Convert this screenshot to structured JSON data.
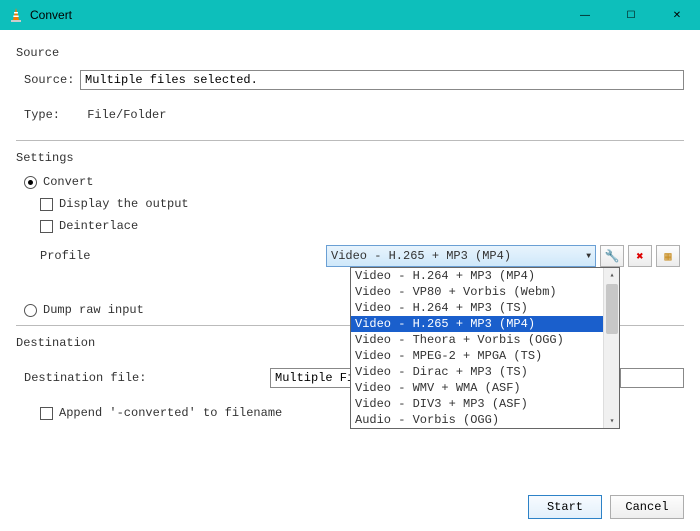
{
  "window": {
    "title": "Convert"
  },
  "source": {
    "section": "Source",
    "label": "Source:",
    "value": "Multiple files selected.",
    "type_label": "Type:",
    "type_value": "File/Folder"
  },
  "settings": {
    "section": "Settings",
    "convert_label": "Convert",
    "display_output_label": "Display the output",
    "deinterlace_label": "Deinterlace",
    "profile_label": "Profile",
    "profile_selected": "Video - H.265 + MP3 (MP4)",
    "profile_options": [
      "Video - H.264 + MP3 (MP4)",
      "Video - VP80 + Vorbis (Webm)",
      "Video - H.264 + MP3 (TS)",
      "Video - H.265 + MP3 (MP4)",
      "Video - Theora + Vorbis (OGG)",
      "Video - MPEG-2 + MPGA (TS)",
      "Video - Dirac + MP3 (TS)",
      "Video - WMV + WMA (ASF)",
      "Video - DIV3 + MP3 (ASF)",
      "Audio - Vorbis (OGG)"
    ],
    "dump_raw_label": "Dump raw input"
  },
  "destination": {
    "section": "Destination",
    "file_label": "Destination file:",
    "file_value": "Multiple Fil",
    "append_label": "Append '-converted' to filename"
  },
  "buttons": {
    "start": "Start",
    "cancel": "Cancel"
  }
}
